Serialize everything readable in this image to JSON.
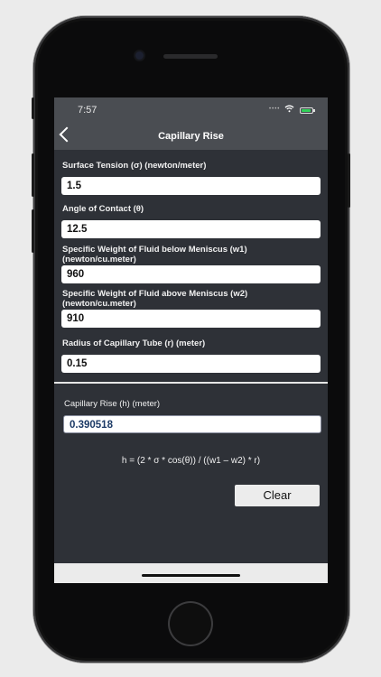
{
  "status": {
    "time": "7:57"
  },
  "nav": {
    "title": "Capillary Rise"
  },
  "form": {
    "surface_tension_label": "Surface Tension (σ) (newton/meter)",
    "surface_tension_value": "1.5",
    "angle_label": "Angle of Contact (θ)",
    "angle_value": "12.5",
    "w1_label": "Specific Weight of Fluid below Meniscus (w1) (newton/cu.meter)",
    "w1_value": "960",
    "w2_label": "Specific Weight of Fluid above Meniscus (w2) (newton/cu.meter)",
    "w2_value": "910",
    "radius_label": "Radius of Capillary Tube (r) (meter)",
    "radius_value": "0.15"
  },
  "result": {
    "label": "Capillary Rise (h) (meter)",
    "value": "0.390518"
  },
  "formula": "h = (2 * σ *  cos(θ)) / ((w1 – w2) * r)",
  "actions": {
    "clear_label": "Clear"
  },
  "colors": {
    "screen_bg": "#2e3137",
    "bar_bg": "#4a4d52",
    "result_text": "#1c3a66",
    "battery": "#31d158"
  },
  "icons": [
    "back-chevron-icon",
    "wifi-icon",
    "battery-icon",
    "signal-icon"
  ]
}
